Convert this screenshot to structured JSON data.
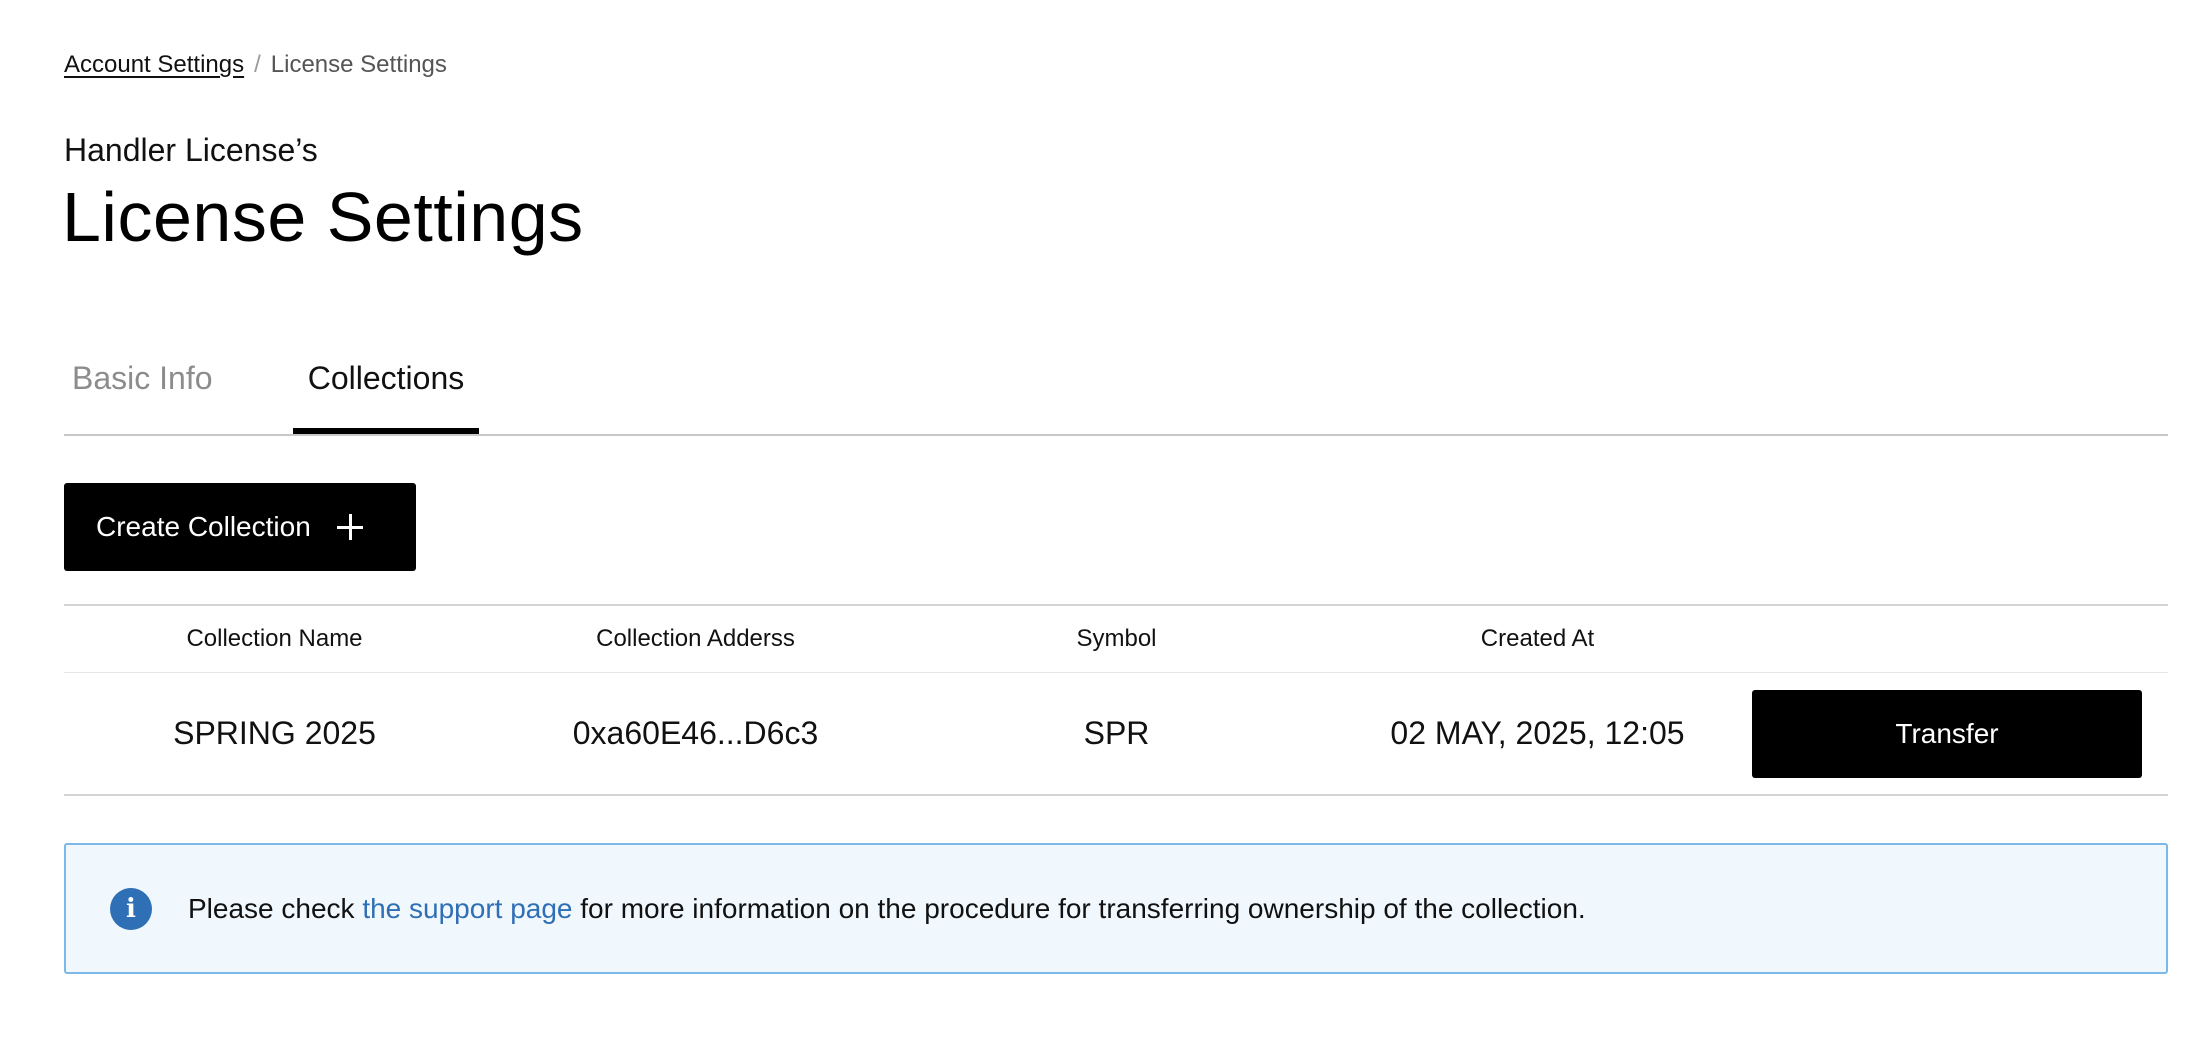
{
  "breadcrumb": {
    "parent": "Account Settings",
    "separator": "/",
    "current": "License Settings"
  },
  "header": {
    "subtitle": "Handler License’s",
    "title": "License Settings"
  },
  "tabs": [
    {
      "label": "Basic Info",
      "active": false
    },
    {
      "label": "Collections",
      "active": true
    }
  ],
  "create_button": {
    "label": "Create Collection",
    "icon": "plus-icon"
  },
  "table": {
    "headers": [
      "Collection Name",
      "Collection Adderss",
      "Symbol",
      "Created At",
      ""
    ],
    "rows": [
      {
        "name": "SPRING 2025",
        "address": "0xa60E46...D6c3",
        "symbol": "SPR",
        "created_at": "02 MAY, 2025, 12:05",
        "action": "Transfer"
      }
    ]
  },
  "info": {
    "icon": "info-icon",
    "text_before": "Please check ",
    "link": "the support page",
    "text_after": " for more information on the procedure for transferring ownership of the collection."
  },
  "colors": {
    "primary": "#000000",
    "info_bg": "#f0f7fd",
    "info_border": "#7db9e8",
    "link": "#2f6fb5"
  }
}
